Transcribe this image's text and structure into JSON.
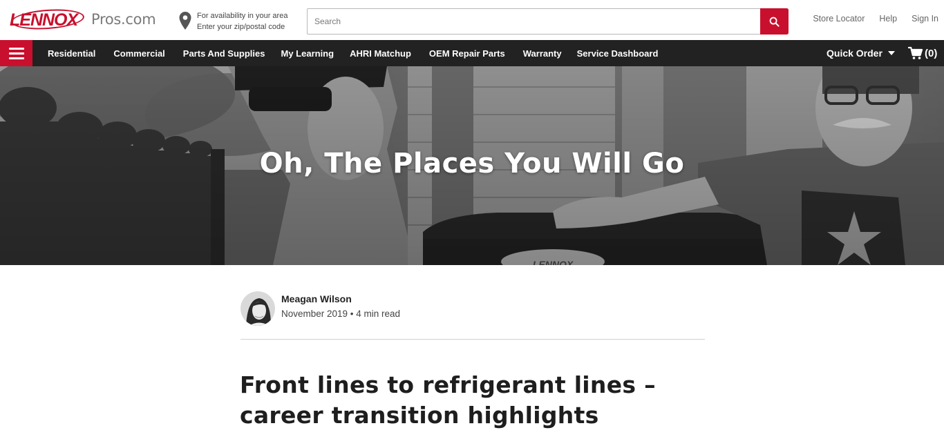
{
  "brand": {
    "logo_text": "LENNOX",
    "site_name": "Pros.com",
    "accent_color": "#c8102e",
    "nav_bg": "#222222"
  },
  "location": {
    "line1": "For availability in your area",
    "line2": "Enter your zip/postal code"
  },
  "search": {
    "placeholder": "Search"
  },
  "util_links": {
    "store_locator": "Store Locator",
    "help": "Help",
    "sign_in": "Sign In"
  },
  "nav": {
    "items": [
      {
        "label": "Residential"
      },
      {
        "label": "Commercial"
      },
      {
        "label": "Parts And Supplies"
      },
      {
        "label": "My Learning"
      },
      {
        "label": "AHRI Matchup"
      },
      {
        "label": "OEM Repair Parts"
      },
      {
        "label": "Warranty"
      },
      {
        "label": "Service Dashboard"
      }
    ],
    "quick_order": "Quick Order",
    "cart_count": "(0)"
  },
  "hero": {
    "title": "Oh, The Places You Will Go",
    "unit_brand_text": "LENNOX"
  },
  "article": {
    "author_name": "Meagan Wilson",
    "meta": "November 2019 • 4 min read",
    "title": "Front lines to refrigerant lines – career transition highlights"
  },
  "icons": {
    "menu": "hamburger-icon",
    "location": "map-pin-icon",
    "search": "search-icon",
    "cart": "cart-icon",
    "dropdown": "caret-down-icon"
  }
}
